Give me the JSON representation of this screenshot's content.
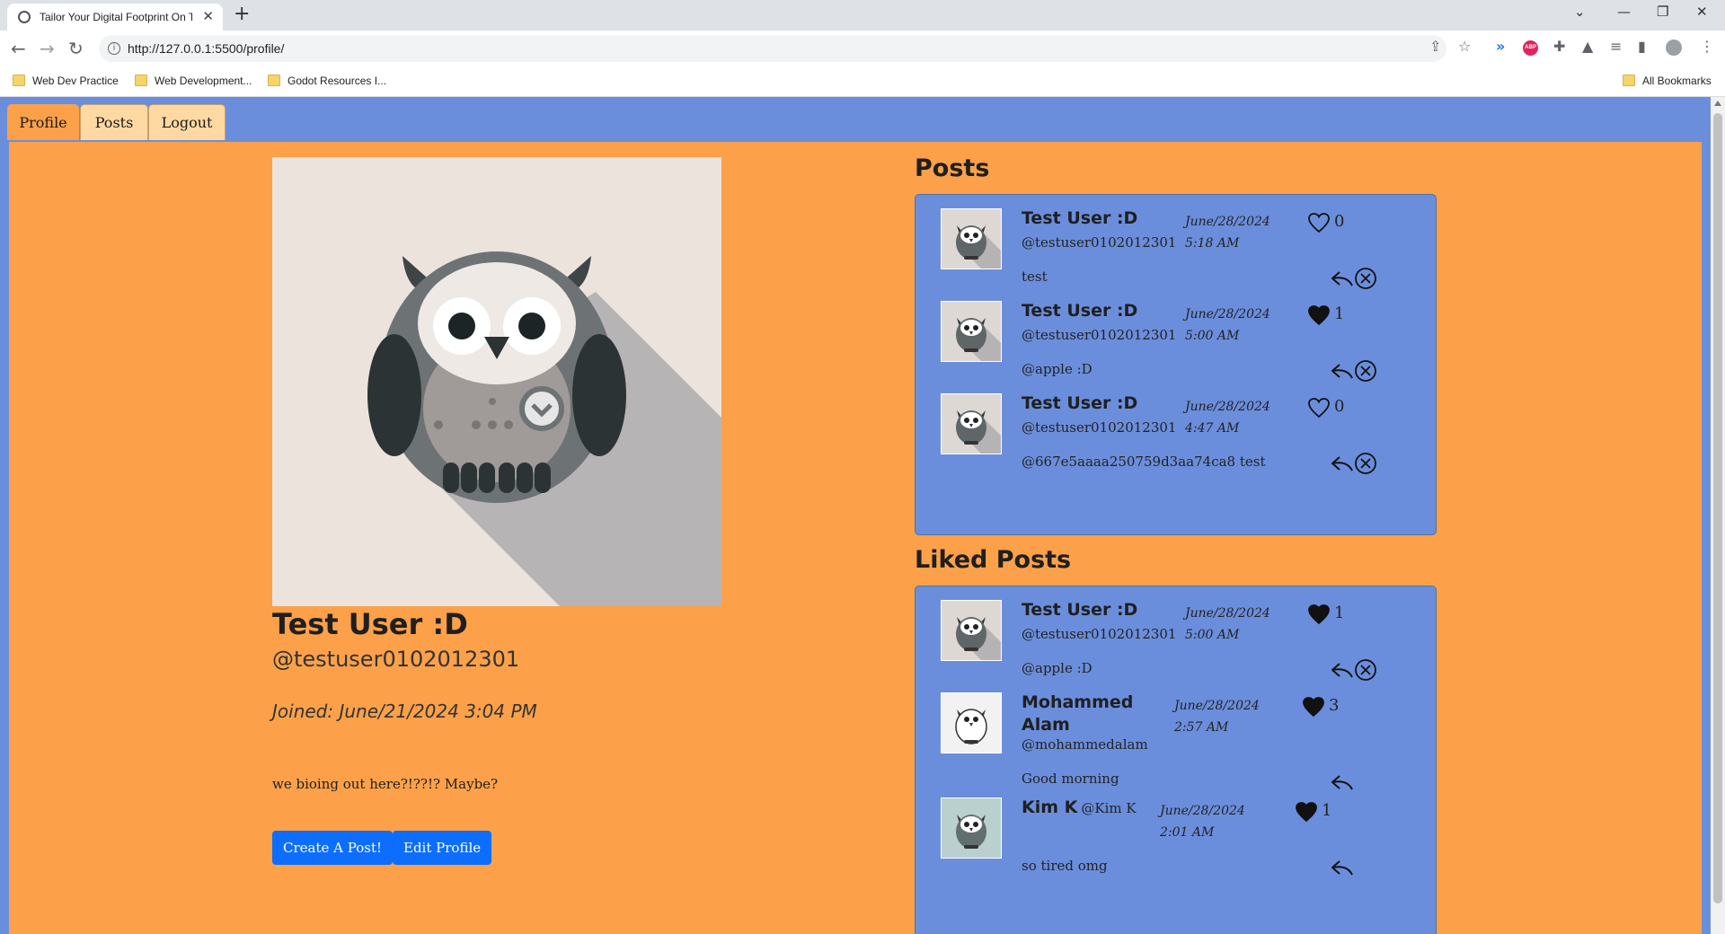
{
  "browser": {
    "tab_title": "Tailor Your Digital Footprint On Th",
    "url": "http://127.0.0.1:5500/profile/",
    "bookmarks": [
      "Web Dev Practice",
      "Web Development...",
      "Godot Resources I...",
      "All Bookmarks"
    ],
    "abp_badge": "ABP"
  },
  "nav": {
    "tabs": [
      "Profile",
      "Posts",
      "Logout"
    ],
    "active": "Profile"
  },
  "profile": {
    "name": "Test User :D",
    "handle": "@testuser0102012301",
    "joined": "Joined: June/21/2024 3:04 PM",
    "bio": "we bioing out here?!??!? Maybe?",
    "buttons": {
      "create": "Create A Post!",
      "edit": "Edit Profile"
    }
  },
  "posts": {
    "title": "Posts",
    "items": [
      {
        "name": "Test User :D",
        "handle": "@testuser0102012301",
        "date": "June/28/2024",
        "time": "5:18 AM",
        "likes": "0",
        "liked": false,
        "text": "test",
        "deletable": true,
        "avatar": "owl-gray-icon"
      },
      {
        "name": "Test User :D",
        "handle": "@testuser0102012301",
        "date": "June/28/2024",
        "time": "5:00 AM",
        "likes": "1",
        "liked": true,
        "text": "@apple :D",
        "deletable": true,
        "avatar": "owl-gray-icon"
      },
      {
        "name": "Test User :D",
        "handle": "@testuser0102012301",
        "date": "June/28/2024",
        "time": "4:47 AM",
        "likes": "0",
        "liked": false,
        "text": "@667e5aaaa250759d3aa74ca8 test",
        "deletable": true,
        "avatar": "owl-gray-icon"
      }
    ]
  },
  "liked_posts": {
    "title": "Liked Posts",
    "items": [
      {
        "name": "Test User :D",
        "handle": "@testuser0102012301",
        "date": "June/28/2024",
        "time": "5:00 AM",
        "likes": "1",
        "liked": true,
        "text": "@apple :D",
        "deletable": true,
        "avatar": "owl-gray-icon"
      },
      {
        "name": "Mohammed",
        "name2": "Alam",
        "handle": "@mohammedalam",
        "date": "June/28/2024",
        "time": "2:57 AM",
        "likes": "3",
        "liked": true,
        "text": "Good morning",
        "deletable": false,
        "avatar": "owl-sketch-icon"
      },
      {
        "name": "Kim K",
        "handle": "@Kim K",
        "date": "June/28/2024",
        "time": "2:01 AM",
        "likes": "1",
        "liked": true,
        "text": "so tired omg",
        "deletable": false,
        "avatar": "owl-teal-icon"
      }
    ]
  },
  "colors": {
    "page_orange": "#fca14a",
    "header_blue": "#6b8edc",
    "button_blue": "#0d6efd",
    "tab_peach": "#ffd9a1"
  }
}
